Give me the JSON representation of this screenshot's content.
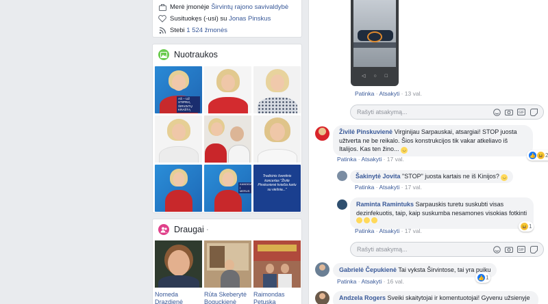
{
  "about": {
    "works_prefix": "Merė įmonėje",
    "works_link": "Širvintų rajono savivaldybė",
    "engaged_prefix": "Susituokęs (-usi) su",
    "engaged_link": "Jonas Pinskus",
    "follow_prefix": "Stebi",
    "follow_link": "1 524 žmonės"
  },
  "photos": {
    "title": "Nuotraukos",
    "tag1": "AŠ – UŽ STIPRIĄ ŠIRVINTŲ KRAŠTĄ",
    "tag2": "KANDIDATĖ Į MERUS",
    "tag3": "Tradicinis šventinis koncertas \"Živilė Pinskuvienė kviečia kartu su viešnia...\""
  },
  "friends": {
    "title": "Draugai",
    "list": [
      {
        "first": "Nomeda",
        "last": "Drazdienė"
      },
      {
        "first": "Rūta Skeberytė",
        "last": "Boguckienė"
      },
      {
        "first": "Raimondas",
        "last": "Petuska"
      }
    ]
  },
  "comments": {
    "like": "Patinka",
    "reply": "Atsakyti",
    "reply_placeholder": "Rašyti atsakymą...",
    "c0_time": "13 val.",
    "c1": {
      "name": "Živilė Pinskuvienė",
      "text": "Virginijau Sarpauskai, atsargiai! STOP juosta užtverta ne be reikalo. Šios konstrukcijos tik vakar atkeliavo iš Italijos. Kas ten žino...",
      "time": "17 val.",
      "reactions": "23"
    },
    "c2": {
      "name": "Šakinytė Jovita",
      "text": "\"STOP\" juosta kartais ne iš Kinijos?",
      "time": "17 val."
    },
    "c3": {
      "name": "Raminta Ramintuks",
      "text": "Sarpauskis turetu suskubti visas dezinfekuotis, taip, kaip suskumba nesamones visokias fotkinti",
      "time": "17 val.",
      "reactions": "1"
    },
    "c4": {
      "name": "Gabrielė Čepukienė",
      "text": "Tai vyksta Širvintose, tai yra puiku",
      "time": "16 val.",
      "reactions": "1"
    },
    "c5": {
      "name": "Andzela Rogers",
      "text": "Sveiki skaitytojai ir komentuotojai! Gyvenu užsienyje"
    }
  }
}
